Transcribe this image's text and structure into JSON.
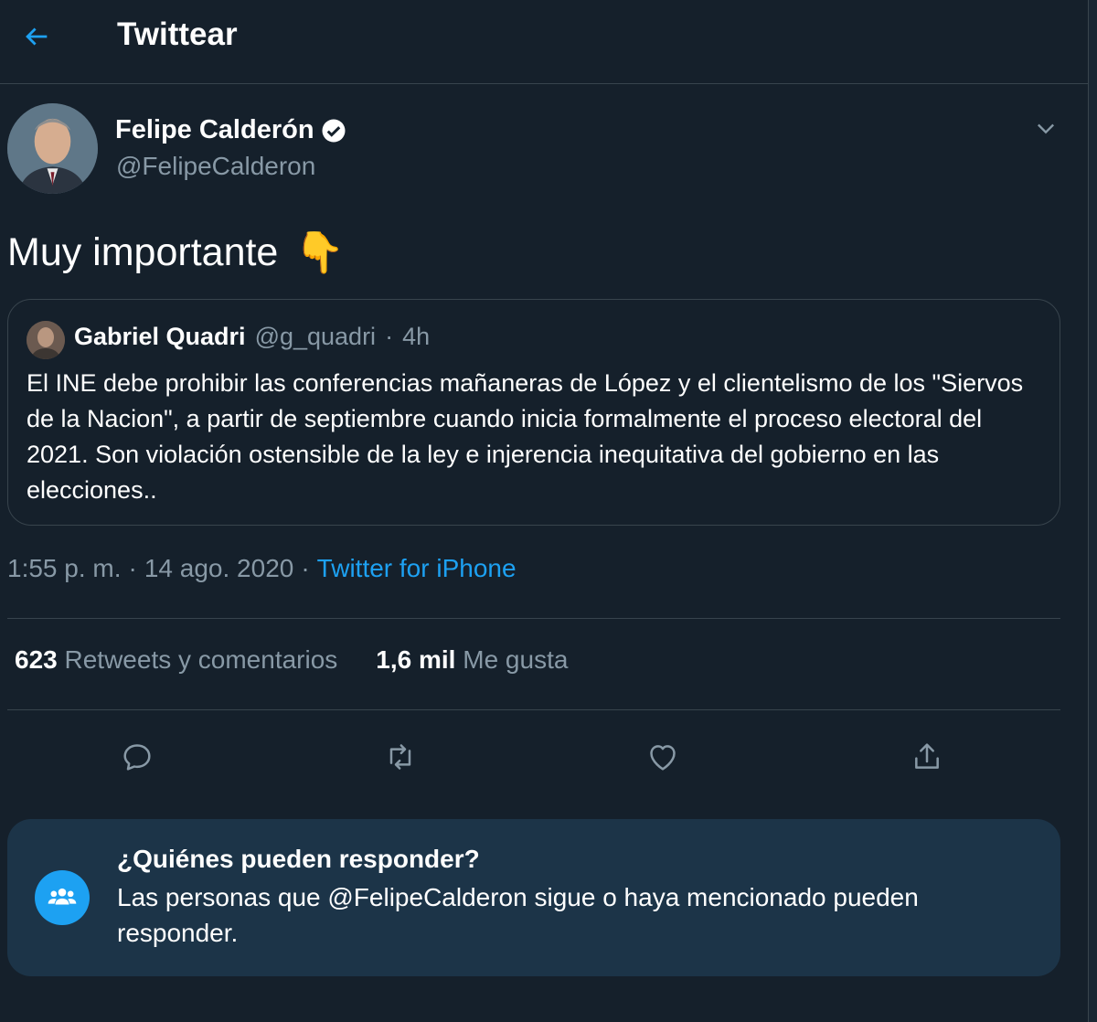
{
  "header": {
    "back_icon": "arrow-left-icon",
    "title": "Twittear"
  },
  "author": {
    "name": "Felipe Calderón",
    "handle": "@FelipeCalderon",
    "verified_icon": "verified-badge-icon"
  },
  "tweet": {
    "text": "Muy importante",
    "emoji": "👇"
  },
  "quoted": {
    "name": "Gabriel Quadri",
    "handle": "@g_quadri",
    "separator": "·",
    "time": "4h",
    "text": "El INE debe prohibir las conferencias  mañaneras de López y el clientelismo de los \"Siervos de la Nacion\", a partir de septiembre cuando inicia formalmente el proceso electoral del 2021. Son violación ostensible de la ley e injerencia inequitativa del gobierno en las elecciones.."
  },
  "meta": {
    "time": "1:55 p. m.",
    "sep1": "·",
    "date": "14 ago. 2020",
    "sep2": "·",
    "source": "Twitter for iPhone"
  },
  "stats": {
    "retweets_count": "623",
    "retweets_label": "Retweets y comentarios",
    "likes_count": "1,6 mil",
    "likes_label": "Me gusta"
  },
  "actions": [
    "reply-icon",
    "retweet-icon",
    "like-icon",
    "share-icon"
  ],
  "reply_notice": {
    "icon": "people-icon",
    "title": "¿Quiénes pueden responder?",
    "body": "Las personas que @FelipeCalderon sigue o haya mencionado pueden responder."
  },
  "colors": {
    "background": "#15202b",
    "accent": "#1da1f2",
    "secondary_text": "#8899a6",
    "border": "#38444d",
    "notice_background": "#1c3448"
  }
}
